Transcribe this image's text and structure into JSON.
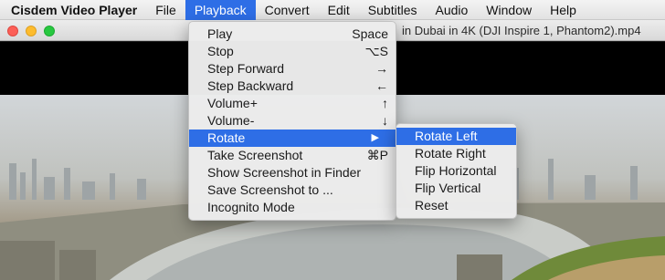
{
  "menubar": {
    "app_name": "Cisdem Video Player",
    "items": [
      "File",
      "Playback",
      "Convert",
      "Edit",
      "Subtitles",
      "Audio",
      "Window",
      "Help"
    ]
  },
  "window": {
    "title": "in Dubai in 4K (DJI Inspire 1, Phantom2).mp4"
  },
  "playback_menu": {
    "items": [
      {
        "label": "Play",
        "shortcut": "Space"
      },
      {
        "label": "Stop",
        "shortcut": "⌥S"
      },
      {
        "label": "Step Forward",
        "shortcut": "→"
      },
      {
        "label": "Step Backward",
        "shortcut": "←"
      },
      {
        "label": "Volume+",
        "shortcut": "↑"
      },
      {
        "label": "Volume-",
        "shortcut": "↓"
      },
      {
        "label": "Rotate",
        "submenu_arrow": "▶"
      },
      {
        "label": "Take Screenshot",
        "shortcut": "⌘P"
      },
      {
        "label": "Show Screenshot in Finder",
        "shortcut": ""
      },
      {
        "label": "Save Screenshot to ...",
        "shortcut": ""
      },
      {
        "label": "Incognito Mode",
        "shortcut": ""
      }
    ]
  },
  "rotate_submenu": {
    "items": [
      "Rotate Left",
      "Rotate Right",
      "Flip Horizontal",
      "Flip Vertical",
      "Reset"
    ]
  },
  "colors": {
    "accent": "#2e6ee6"
  }
}
